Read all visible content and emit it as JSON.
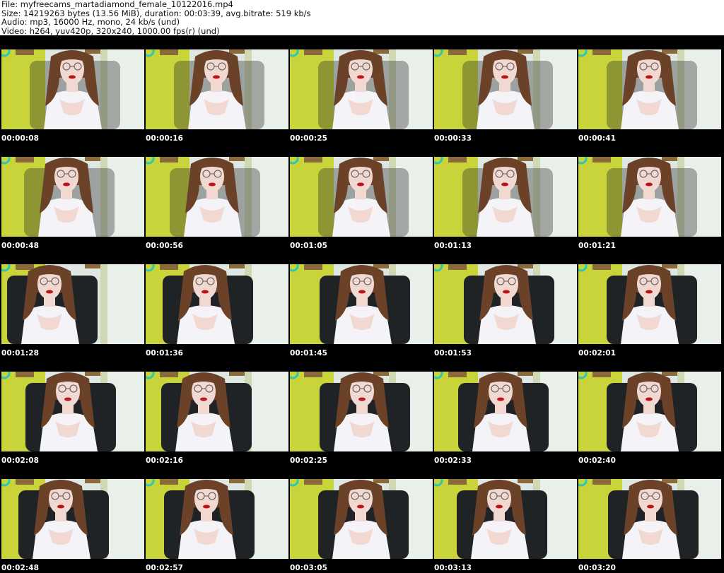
{
  "info": {
    "file_line": "File: myfreecams_martadiamond_female_10122016.mp4",
    "size_line": "Size: 14219263 bytes (13.56 MiB), duration: 00:03:39, avg.bitrate: 519 kb/s",
    "audio_line": "Audio: mp3, 16000 Hz, mono, 24 kb/s (und)",
    "video_line": "Video: h264, yuv420p, 320x240, 1000.00 fps(r) (und)"
  },
  "thumbnails": [
    {
      "timestamp": "00:00:08"
    },
    {
      "timestamp": "00:00:16"
    },
    {
      "timestamp": "00:00:25"
    },
    {
      "timestamp": "00:00:33"
    },
    {
      "timestamp": "00:00:41"
    },
    {
      "timestamp": "00:00:48"
    },
    {
      "timestamp": "00:00:56"
    },
    {
      "timestamp": "00:01:05"
    },
    {
      "timestamp": "00:01:13"
    },
    {
      "timestamp": "00:01:21"
    },
    {
      "timestamp": "00:01:28"
    },
    {
      "timestamp": "00:01:36"
    },
    {
      "timestamp": "00:01:45"
    },
    {
      "timestamp": "00:01:53"
    },
    {
      "timestamp": "00:02:01"
    },
    {
      "timestamp": "00:02:08"
    },
    {
      "timestamp": "00:02:16"
    },
    {
      "timestamp": "00:02:25"
    },
    {
      "timestamp": "00:02:33"
    },
    {
      "timestamp": "00:02:40"
    },
    {
      "timestamp": "00:02:48"
    },
    {
      "timestamp": "00:02:57"
    },
    {
      "timestamp": "00:03:05"
    },
    {
      "timestamp": "00:03:13"
    },
    {
      "timestamp": "00:03:20"
    }
  ],
  "colors": {
    "background": "#000000",
    "wall_yellow": "#c8d43a",
    "wall_light": "#dfe7e2",
    "chair": "#1f2325",
    "hair": "#6b4128",
    "skin": "#f1d9d2",
    "top": "#f4f4f8",
    "lips": "#c1121a",
    "teal_ring": "#29c9b4"
  }
}
